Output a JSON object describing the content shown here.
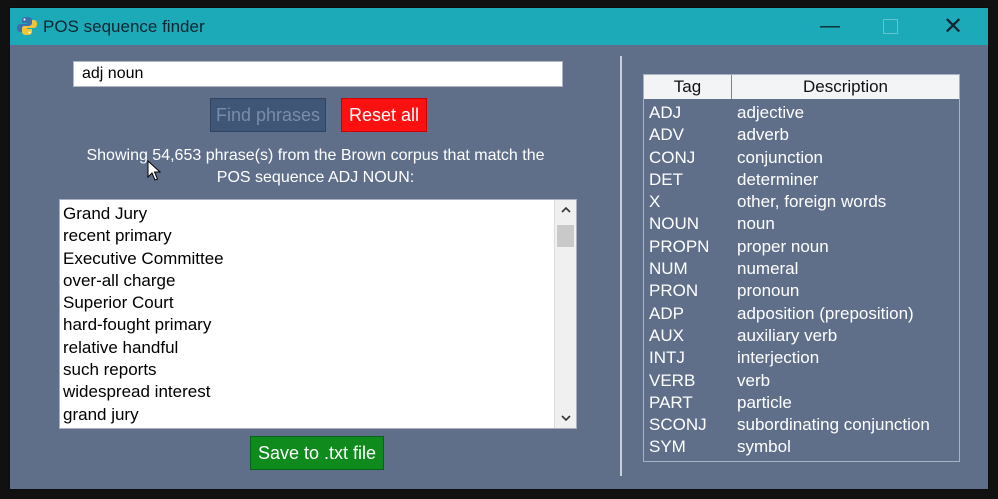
{
  "window": {
    "title": "POS sequence finder",
    "controls": {
      "minimize": "—",
      "close": "✕"
    }
  },
  "search": {
    "value": "adj noun"
  },
  "buttons": {
    "find": "Find phrases",
    "reset": "Reset all",
    "save": "Save to .txt file"
  },
  "status": {
    "line1": "Showing 54,653 phrase(s) from the Brown corpus that match the",
    "line2": "POS sequence ADJ NOUN:"
  },
  "phrases": [
    "Grand Jury",
    "recent primary",
    "Executive Committee",
    "over-all charge",
    "Superior Court",
    "hard-fought primary",
    "relative handful",
    "such reports",
    "widespread interest",
    "grand jury"
  ],
  "tag_table": {
    "headers": {
      "tag": "Tag",
      "description": "Description"
    },
    "rows": [
      {
        "tag": "ADJ",
        "description": "adjective"
      },
      {
        "tag": "ADV",
        "description": "adverb"
      },
      {
        "tag": "CONJ",
        "description": "conjunction"
      },
      {
        "tag": "DET",
        "description": "determiner"
      },
      {
        "tag": "X",
        "description": "other, foreign words"
      },
      {
        "tag": "NOUN",
        "description": "noun"
      },
      {
        "tag": "PROPN",
        "description": "proper noun"
      },
      {
        "tag": "NUM",
        "description": "numeral"
      },
      {
        "tag": "PRON",
        "description": "pronoun"
      },
      {
        "tag": "ADP",
        "description": "adposition (preposition)"
      },
      {
        "tag": "AUX",
        "description": "auxiliary verb"
      },
      {
        "tag": "INTJ",
        "description": "interjection"
      },
      {
        "tag": "VERB",
        "description": "verb"
      },
      {
        "tag": "PART",
        "description": "particle"
      },
      {
        "tag": "SCONJ",
        "description": "subordinating conjunction"
      },
      {
        "tag": "SYM",
        "description": "symbol"
      }
    ]
  },
  "colors": {
    "titlebar": "#1daab8",
    "window_bg": "#5f6f8a",
    "reset_button": "#ff1010",
    "save_button": "#0f8a1c",
    "find_button_disabled": "#3f5677"
  },
  "icons": {
    "app": "python-icon",
    "cursor": "mouse-pointer-icon",
    "scroll_up": "chevron-up-icon",
    "scroll_down": "chevron-down-icon"
  }
}
